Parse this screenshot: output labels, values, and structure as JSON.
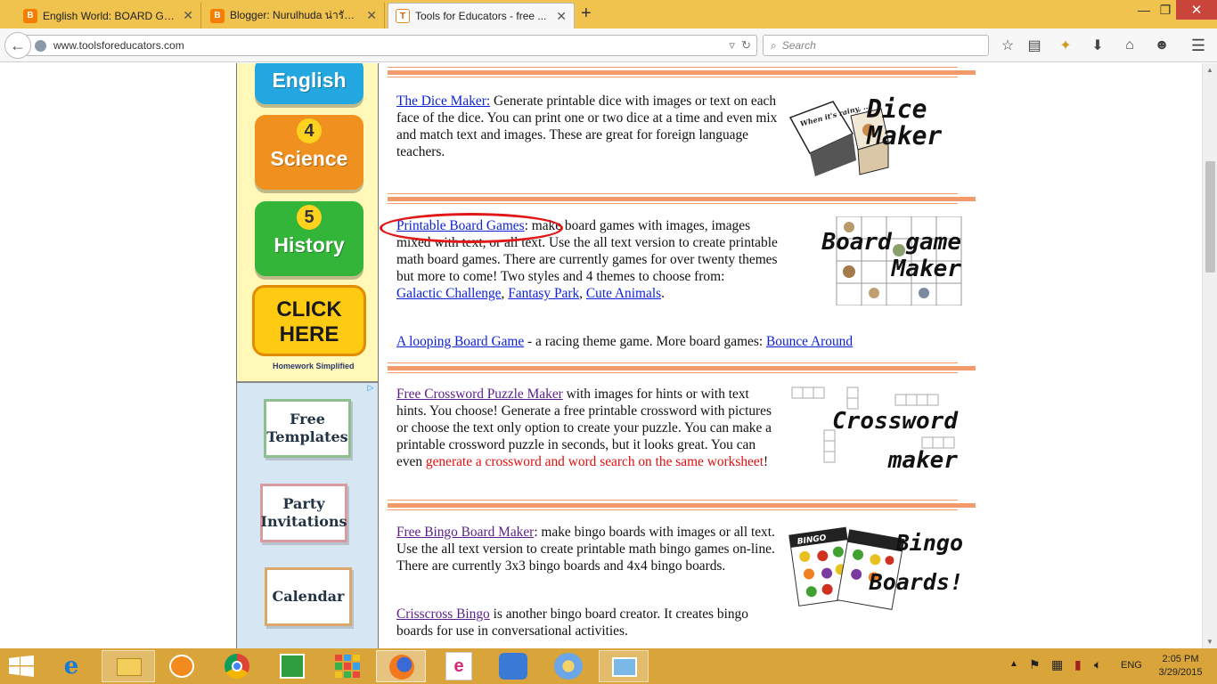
{
  "tabs": [
    {
      "title": "English World: BOARD GA...",
      "icon": "blogger-icon"
    },
    {
      "title": "Blogger: Nurulhuda น่ารักก...",
      "icon": "blogger-icon"
    },
    {
      "title": "Tools for Educators - free ...",
      "icon": "tfe-icon"
    }
  ],
  "window_controls": {
    "minimize": "—",
    "restore": "❐",
    "close": "✕"
  },
  "url": "www.toolsforeducators.com",
  "search_placeholder": "Search",
  "left_ad": {
    "subjects": [
      {
        "number": "",
        "label": "English"
      },
      {
        "number": "4",
        "label": "Science"
      },
      {
        "number": "5",
        "label": "History"
      }
    ],
    "click_here": "CLICK HERE",
    "logo_text": "Homework Simplified",
    "templates": [
      "Free Templates",
      "Party Invitations",
      "Calendar"
    ]
  },
  "sections": {
    "dice": {
      "link": "The Dice Maker:",
      "text": " Generate printable dice with images or text on each face of the dice. You can print one or two dice at a time and even mix and match text and images. These are great for foreign language teachers.",
      "art_title": "Dice Maker",
      "art_die_text": "When it's rainy, ..."
    },
    "board": {
      "link": "Printable Board Games",
      "text": ": make board games with images, images mixed with text, or all text. Use the all text version to create printable math board games. There are currently games for over twenty themes but more to come! Two styles and 4 themes to choose from:",
      "themes": [
        "Galactic Challenge",
        "Fantasy Park",
        "Cute Animals"
      ],
      "looping_link": "A looping Board Game",
      "looping_text": " - a racing theme game. More board games: ",
      "bounce_link": "Bounce Around",
      "art_title": "Board game Maker"
    },
    "crossword": {
      "link": "Free Crossword Puzzle Maker",
      "text": " with images for hints or with text hints.  You choose!  Generate a free printable crossword with pictures or choose the text only option to create your puzzle.  You can make a printable crossword puzzle in seconds, but it looks great.  You can even ",
      "red_text": "generate a crossword and word search on the same worksheet",
      "end": "!",
      "art_title": "Crossword maker"
    },
    "bingo": {
      "link": "Free Bingo Board Maker",
      "text": ": make bingo boards with images or all text.  Use the all text version to create printable math bingo games on-line. There are currently 3x3 bingo boards and 4x4 bingo boards.",
      "crisscross_link": "Crisscross Bingo",
      "crisscross_text": " is another bingo board creator. It creates bingo boards for use in conversational activities.",
      "art_title": "Bingo Boards!",
      "card_label": "BINGO"
    }
  },
  "taskbar": {
    "lang": "ENG",
    "time": "2:05 PM",
    "date": "3/29/2015",
    "apps": [
      "internet-explorer",
      "file-explorer",
      "paint-bubble",
      "chrome",
      "store",
      "apps-grid",
      "firefox",
      "smart-app",
      "paint",
      "paint-brush",
      "photo-viewer"
    ]
  },
  "colors": {
    "tabbar": "#f0c24e",
    "divider": "#f39a6a",
    "link": "#0b1fd6",
    "visited": "#5a1e8a",
    "highlight_oval": "#e01818",
    "taskbar": "#d9a43a"
  }
}
